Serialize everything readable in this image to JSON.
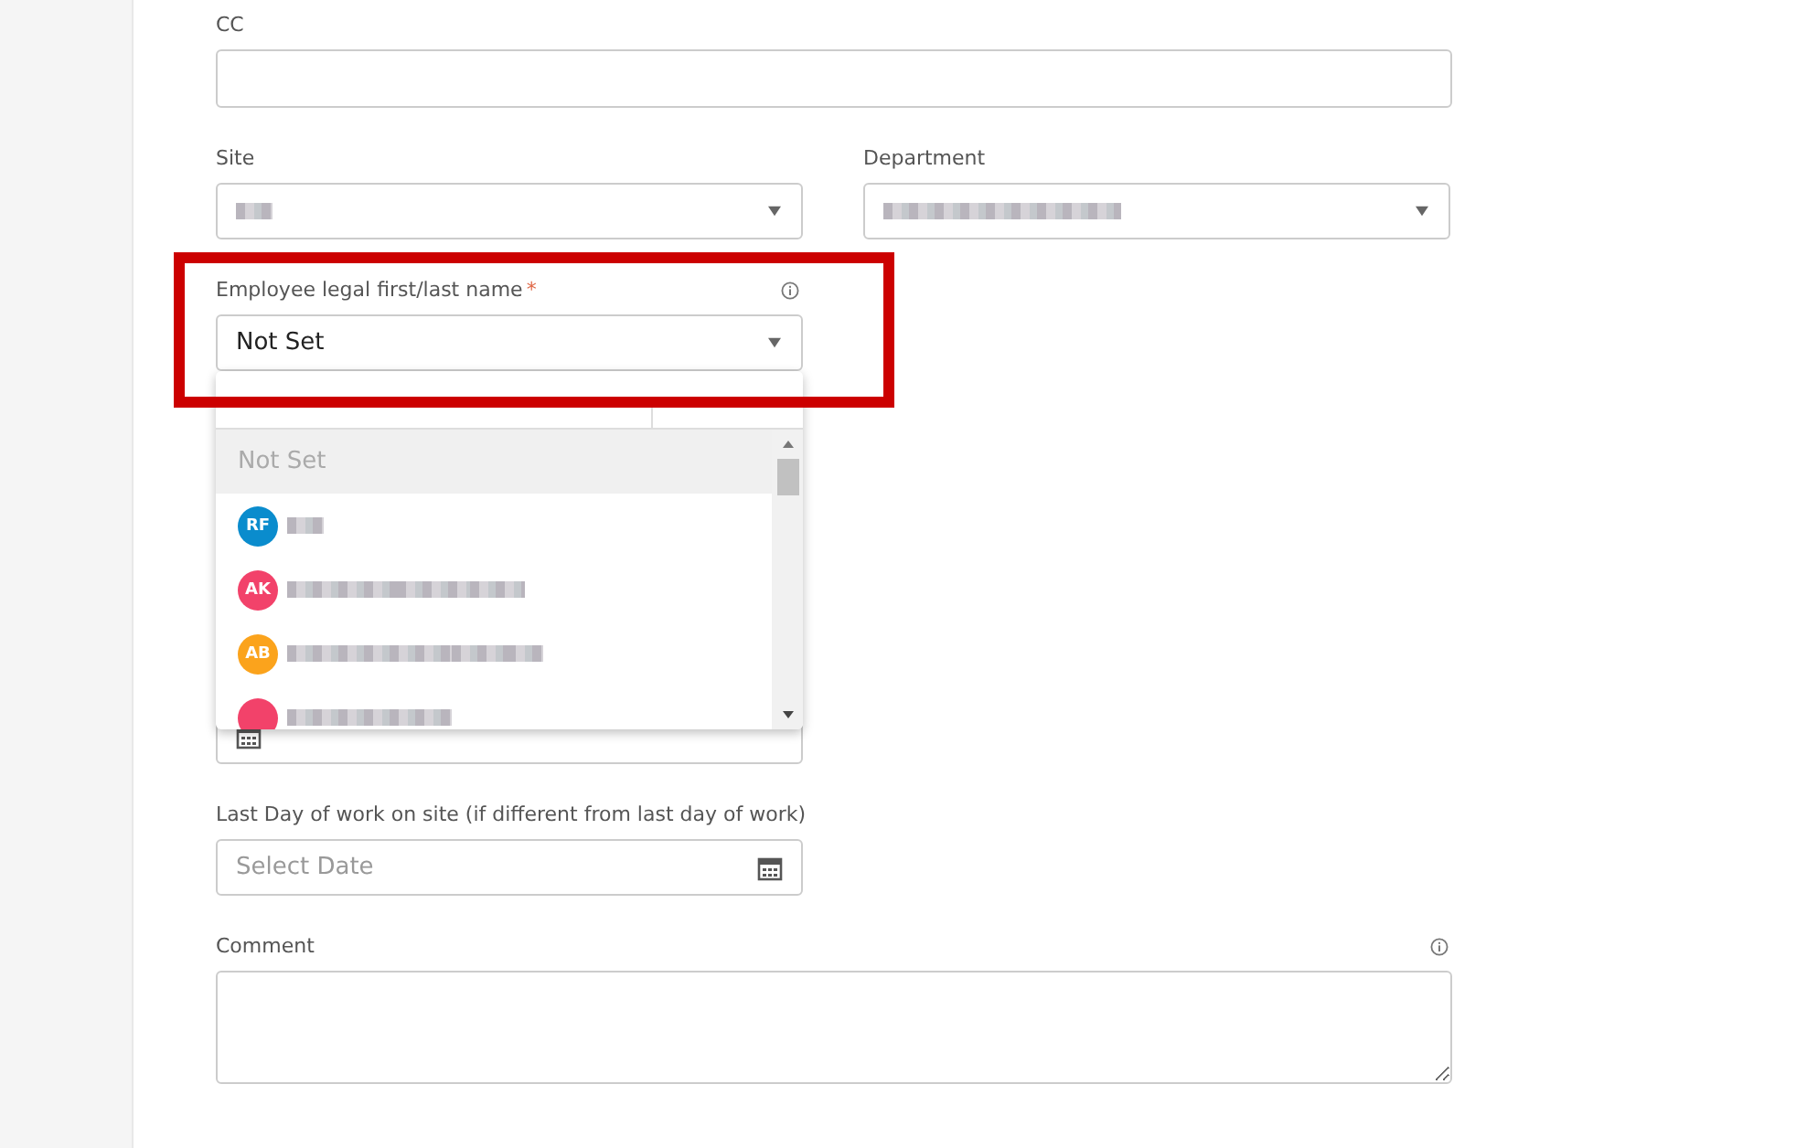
{
  "cc": {
    "label": "CC"
  },
  "site": {
    "label": "Site"
  },
  "department": {
    "label": "Department"
  },
  "employee": {
    "label": "Employee legal first/last name",
    "required_mark": "*",
    "value": "Not Set",
    "highlighted": true,
    "dropdown": {
      "items": [
        {
          "kind": "none",
          "label": "Not Set",
          "selected": true
        },
        {
          "kind": "person",
          "initials": "RF",
          "color": "#0a8ccd",
          "selected": false
        },
        {
          "kind": "person",
          "initials": "AK",
          "color": "#f2426a",
          "selected": false
        },
        {
          "kind": "person",
          "initials": "AB",
          "color": "#fba31c",
          "selected": false
        },
        {
          "kind": "person",
          "color": "#f2426a",
          "selected": false
        }
      ]
    }
  },
  "last_day_on_site": {
    "label": "Last Day of work on site (if different from last day of work)",
    "placeholder": "Select Date"
  },
  "comment": {
    "label": "Comment"
  }
}
